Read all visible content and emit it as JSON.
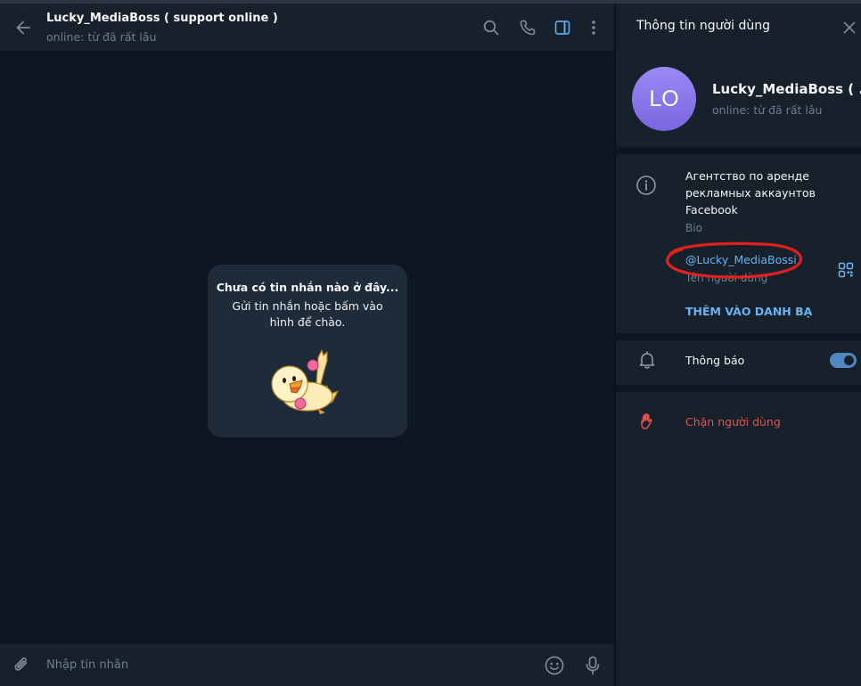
{
  "chat": {
    "title": "Lucky_MediaBoss ( support online )",
    "status": "online: từ đã rất lâu",
    "empty_title": "Chưa có tin nhắn nào ở đây...",
    "empty_text": "Gửi tin nhắn hoặc bấm vào hình để chào.",
    "input_placeholder": "Nhập tin nhắn"
  },
  "header_icons": [
    "back-arrow-icon",
    "search-icon",
    "phone-icon",
    "sidebar-toggle-icon",
    "more-vertical-icon"
  ],
  "composer_icons": [
    "paperclip-icon",
    "emoji-icon",
    "microphone-icon"
  ],
  "panel": {
    "title": "Thông tin người dùng",
    "avatar_initials": "LO",
    "name": "Lucky_MediaBoss ( ...",
    "status": "online: từ đã rất lâu",
    "bio": "Агентство по аренде рекламных аккаунтов Facebook",
    "bio_label": "Bio",
    "username": "@Lucky_MediaBossi",
    "username_label": "Tên người dùng",
    "add_contact": "THÊM VÀO DANH BẠ",
    "notifications_label": "Thông báo",
    "notifications_enabled": true,
    "block_label": "Chặn người dùng"
  },
  "colors": {
    "background": "#0e1621",
    "surface": "#17212b",
    "accent": "#6ab2f2",
    "danger": "#e5514f",
    "muted": "#6d7f8f",
    "annotation": "#e01f1f"
  }
}
